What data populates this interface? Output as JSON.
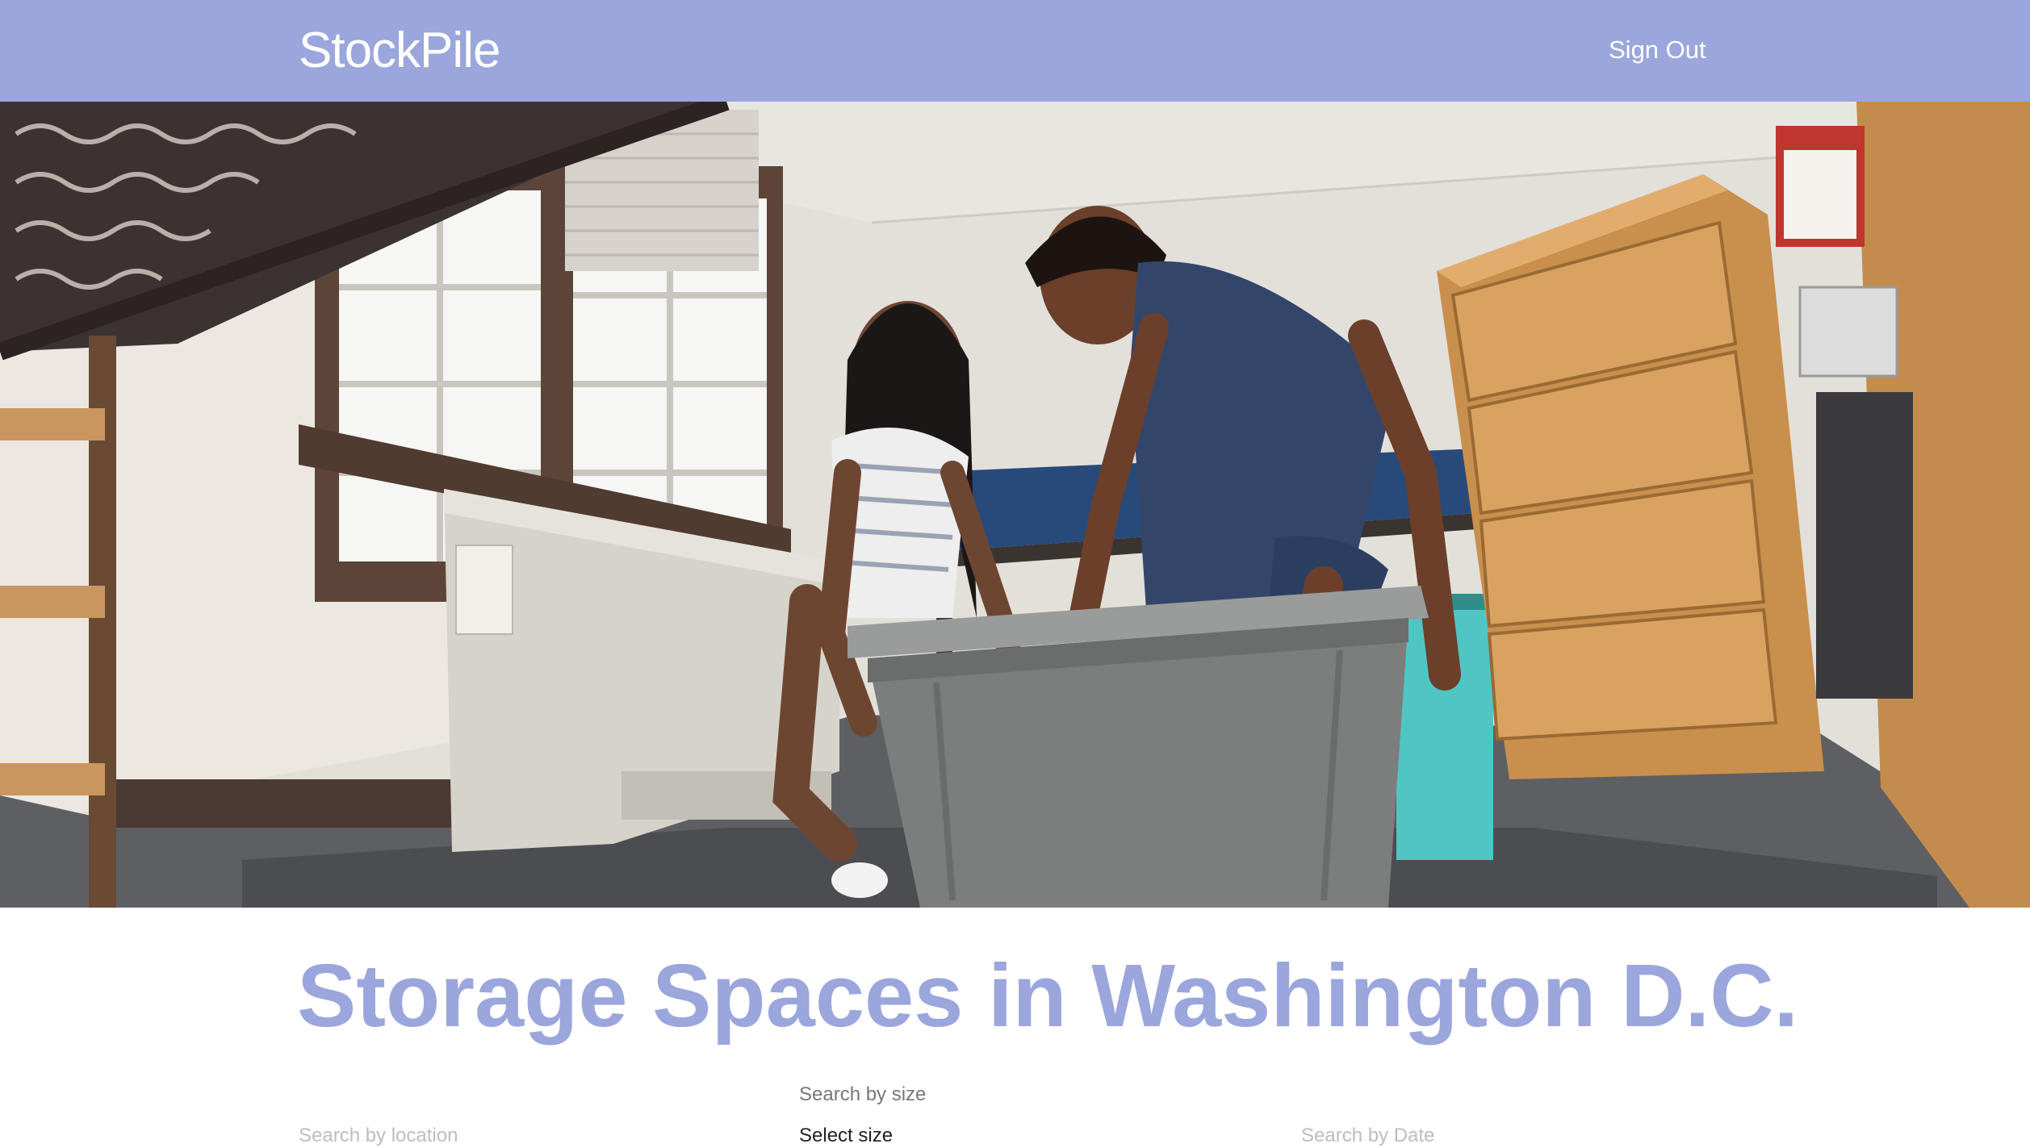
{
  "header": {
    "brand": "StockPile",
    "sign_out_label": "Sign Out"
  },
  "hero": {
    "description_icon": "storage-bin-photo"
  },
  "main": {
    "title": "Storage Spaces in Washington D.C.",
    "filters": {
      "size_label": "Search by size",
      "size_selected": "Select size",
      "location_label": "Search by location",
      "date_label": "Search by Date"
    }
  },
  "colors": {
    "accent": "#9ba6dc",
    "header_text": "#ffffff",
    "muted_text": "#777777"
  }
}
